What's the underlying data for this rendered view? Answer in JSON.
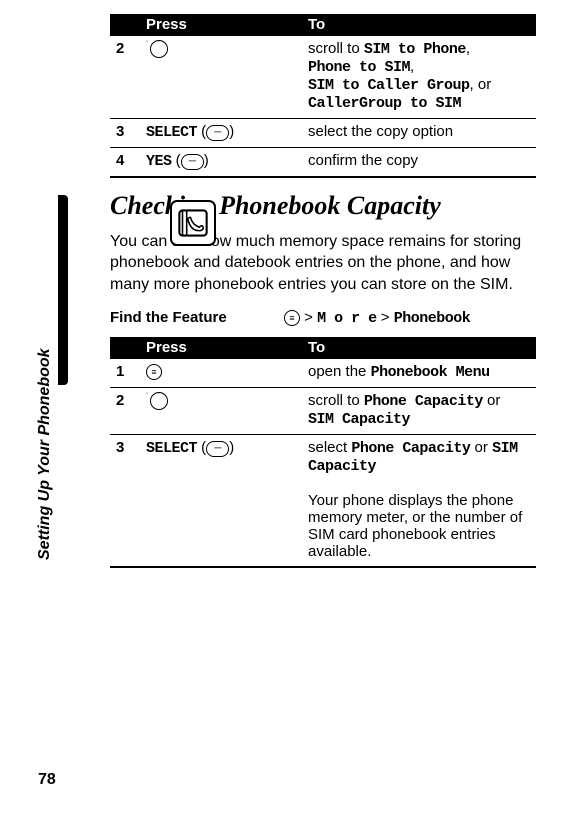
{
  "side_label": "Setting Up Your Phonebook",
  "page_number": "78",
  "table1": {
    "head_press": "Press",
    "head_to": "To",
    "rows": [
      {
        "num": "2",
        "press_html": "<span class='nav-joy'></span>",
        "to_html": "scroll to <span class='dcode'>SIM to Phone</span>,<br><span class='dcode'>Phone to SIM</span>,<br><span class='dcode'>SIM to Caller Group</span>, or<br><span class='dcode'>CallerGroup to SIM</span>"
      },
      {
        "num": "3",
        "press_html": "<span class='softkey'>SELECT</span> (<span class='symbol'>&#9472;</span>)",
        "to_html": "select the copy option"
      },
      {
        "num": "4",
        "press_html": "<span class='softkey'>YES</span> (<span class='symbol'>&#9472;</span>)",
        "to_html": "confirm the copy"
      }
    ]
  },
  "section_heading": "Checking Phonebook Capacity",
  "body_paragraph": "You can see how much memory space remains for storing phonebook and datebook entries on the phone, and how many more phonebook entries you can store on the SIM.",
  "feature": {
    "label": "Find the Feature",
    "path_html": "<span class='circled'>&#8801;</span> &gt; <span class='softkey'>M o r e</span> &gt; <span class='dcode'>Phonebook</span>"
  },
  "table2": {
    "head_press": "Press",
    "head_to": "To",
    "rows": [
      {
        "num": "1",
        "press_html": "<span class='circled'>&#8801;</span>",
        "to_html": "open the <span class='dcode'>Phonebook Menu</span>"
      },
      {
        "num": "2",
        "press_html": "<span class='nav-joy'></span>",
        "to_html": "scroll to <span class='dcode'>Phone Capacity</span> or <span class='dcode'>SIM Capacity</span>"
      },
      {
        "num": "3",
        "press_html": "<span class='softkey'>SELECT</span> (<span class='symbol'>&#9472;</span>)",
        "to_html": "select <span class='dcode'>Phone Capacity</span> or <span class='dcode'>SIM Capacity</span><br><br>Your phone displays the phone memory meter, or the number of SIM card phonebook entries available."
      }
    ]
  }
}
